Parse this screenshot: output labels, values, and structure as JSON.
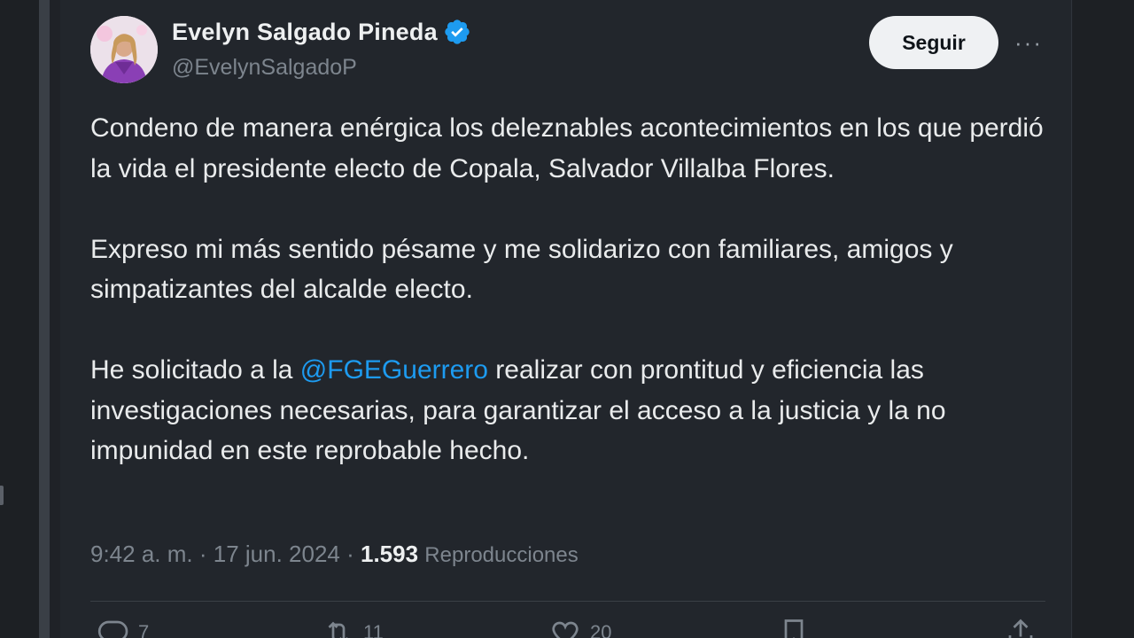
{
  "tweet": {
    "author": {
      "display_name": "Evelyn Salgado Pineda",
      "handle": "@EvelynSalgadoP",
      "verified": true
    },
    "follow_label": "Seguir",
    "more_label": "···",
    "paragraphs": [
      {
        "parts": [
          {
            "text": "Condeno de manera enérgica los deleznables acontecimientos en los que perdió la vida el presidente electo de Copala, Salvador Villalba Flores."
          }
        ]
      },
      {
        "parts": [
          {
            "text": "Expreso mi más sentido pésame y me solidarizo con familiares, amigos y simpatizantes del alcalde electo."
          }
        ]
      },
      {
        "parts": [
          {
            "text": "He solicitado a la "
          },
          {
            "text": "@FGEGuerrero",
            "mention": true
          },
          {
            "text": " realizar con prontitud y eficiencia las investigaciones necesarias, para garantizar el acceso a la justicia y la no impunidad en este reprobable hecho."
          }
        ]
      }
    ],
    "meta": {
      "time": "9:42 a. m.",
      "sep1": " · ",
      "date": "17 jun. 2024",
      "sep2": " · ",
      "views_count": "1.593",
      "views_label": "Reproducciones"
    },
    "actions": {
      "reply_count": "7",
      "retweet_count": "11",
      "like_count": "20"
    }
  },
  "colors": {
    "background": "#22262c",
    "mention": "#1d9bf0",
    "verified_badge": "#1d9bf0",
    "secondary_text": "#7d858e"
  },
  "icons": [
    "verified-badge-icon",
    "more-icon",
    "reply-icon",
    "retweet-icon",
    "like-icon",
    "bookmark-icon",
    "share-icon"
  ]
}
